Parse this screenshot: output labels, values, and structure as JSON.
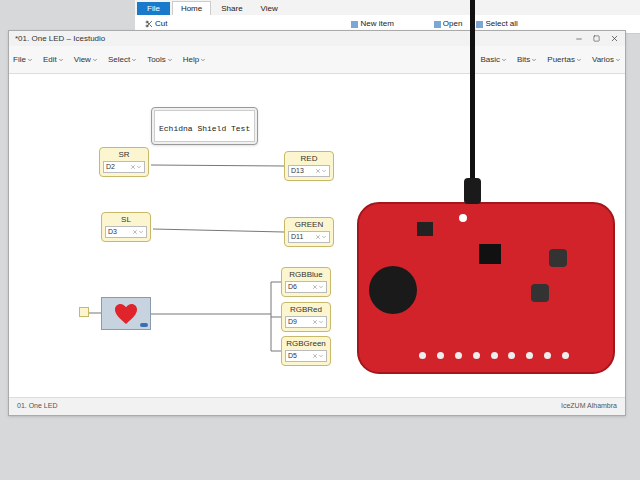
{
  "window": {
    "title": "*01. One LED – Icestudio"
  },
  "explorer_ribbon": {
    "tabs": [
      {
        "label": "File",
        "selected": false
      },
      {
        "label": "Home",
        "selected": true
      },
      {
        "label": "Share",
        "selected": false
      },
      {
        "label": "View",
        "selected": false
      }
    ],
    "commands": [
      "Cut",
      "New item",
      "Open",
      "Select all"
    ]
  },
  "menu": [
    "File",
    "Edit",
    "View",
    "Select",
    "Tools",
    "Help"
  ],
  "menu_right": [
    "Basic",
    "Bits",
    "Puertas",
    "Varios"
  ],
  "diagram": {
    "comment": "Echidna Shield Test",
    "inputs": [
      {
        "label": "SR",
        "pin": "D2"
      },
      {
        "label": "SL",
        "pin": "D3"
      }
    ],
    "outputs": [
      {
        "label": "RED",
        "pin": "D13"
      },
      {
        "label": "GREEN",
        "pin": "D11"
      },
      {
        "label": "RGBBlue",
        "pin": "D6"
      },
      {
        "label": "RGBRed",
        "pin": "D9"
      },
      {
        "label": "RGBGreen",
        "pin": "D5"
      }
    ]
  },
  "status_bar": {
    "left": "01. One LED",
    "right": "IceZUM Alhambra"
  }
}
